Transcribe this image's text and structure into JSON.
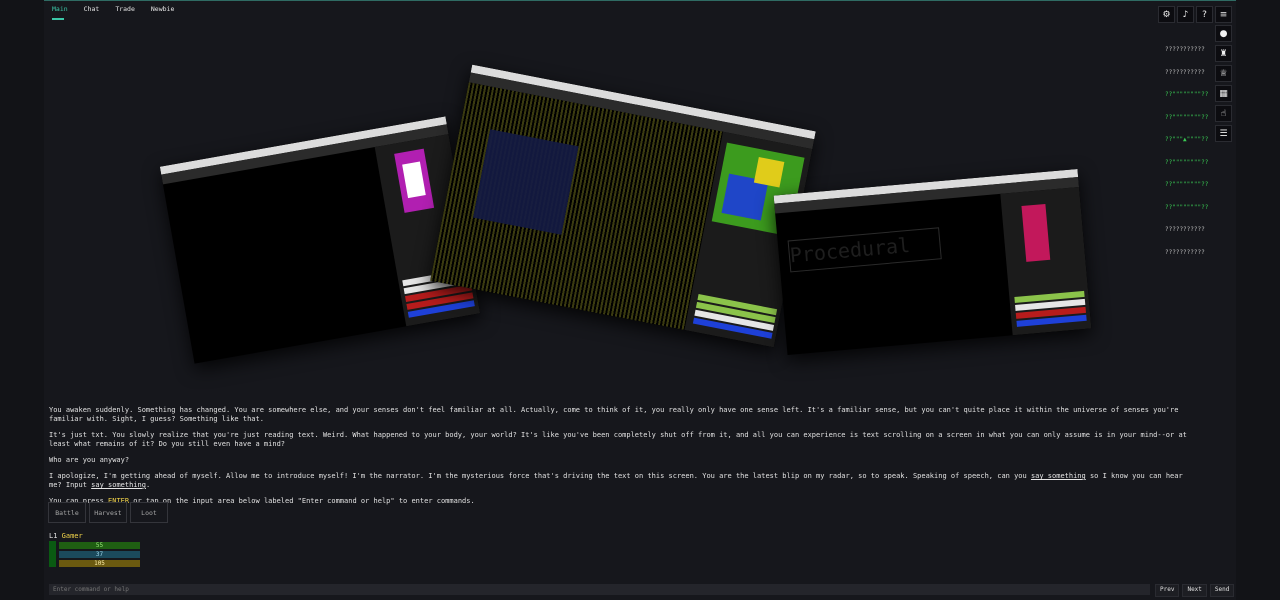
{
  "tabs": [
    "Main",
    "Chat",
    "Trade",
    "Newbie"
  ],
  "icons": {
    "top": [
      "gear-icon",
      "music-icon",
      "help-icon",
      "menu-icon"
    ],
    "side": [
      "user-icon",
      "equipment-icon",
      "trophy-icon",
      "inventory-icon",
      "hand-icon",
      "list-icon"
    ]
  },
  "minimap_rows": [
    "???????????",
    "???????????",
    "??\"\"\"\"\"\"\"\"??",
    "??\"\"\"\"\"\"\"\"??",
    "??\"\"\"▲\"\"\"\"??",
    "??\"\"\"\"\"\"\"\"??",
    "??\"\"\"\"\"\"\"\"??",
    "??\"\"\"\"\"\"\"\"??",
    "???????????",
    "???????????"
  ],
  "story": {
    "p1": "You awaken suddenly. Something has changed. You are somewhere else, and your senses don't feel familiar at all. Actually, come to think of it, you really only have one sense left. It's a familiar sense, but you can't quite place it within the universe of senses you're familiar with. Sight, I guess? Something like that.",
    "p2": "It's just txt. You slowly realize that you're just reading text. Weird. What happened to your body, your world? It's like you've been completely shut off from it, and all you can experience is text scrolling on a screen in what you can only assume is in your mind--or at least what remains of it? Do you still even have a mind?",
    "p3": "Who are you anyway?",
    "p4_pre": "I apologize, I'm getting ahead of myself. Allow me to introduce myself! I'm the narrator. I'm the mysterious force that's driving the text on this screen. You are the latest blip on my radar, so to speak. Speaking of speech, can you ",
    "link1": "say something",
    "p4_mid": " so I know you can hear me? Input ",
    "link2": "say something",
    "p4_end": ".",
    "p5_pre": "You can press ",
    "p5_key": "ENTER",
    "p5_post": " or tap on the input area below labeled \"Enter command or help\" to enter commands."
  },
  "actions": [
    "Battle",
    "Harvest",
    "Loot"
  ],
  "player": {
    "level": "L1",
    "name": "Gamer",
    "hp": "55",
    "mp": "37",
    "xp": "105"
  },
  "command": {
    "placeholder": "Enter command or help"
  },
  "cmd_buttons": [
    "Prev",
    "Next",
    "Send"
  ],
  "colors": {
    "accent": "#3cc7a8",
    "highlight": "#f2d44a",
    "hp": "#1f5f12",
    "mp": "#1b4a5c",
    "xp": "#6b5a10"
  }
}
